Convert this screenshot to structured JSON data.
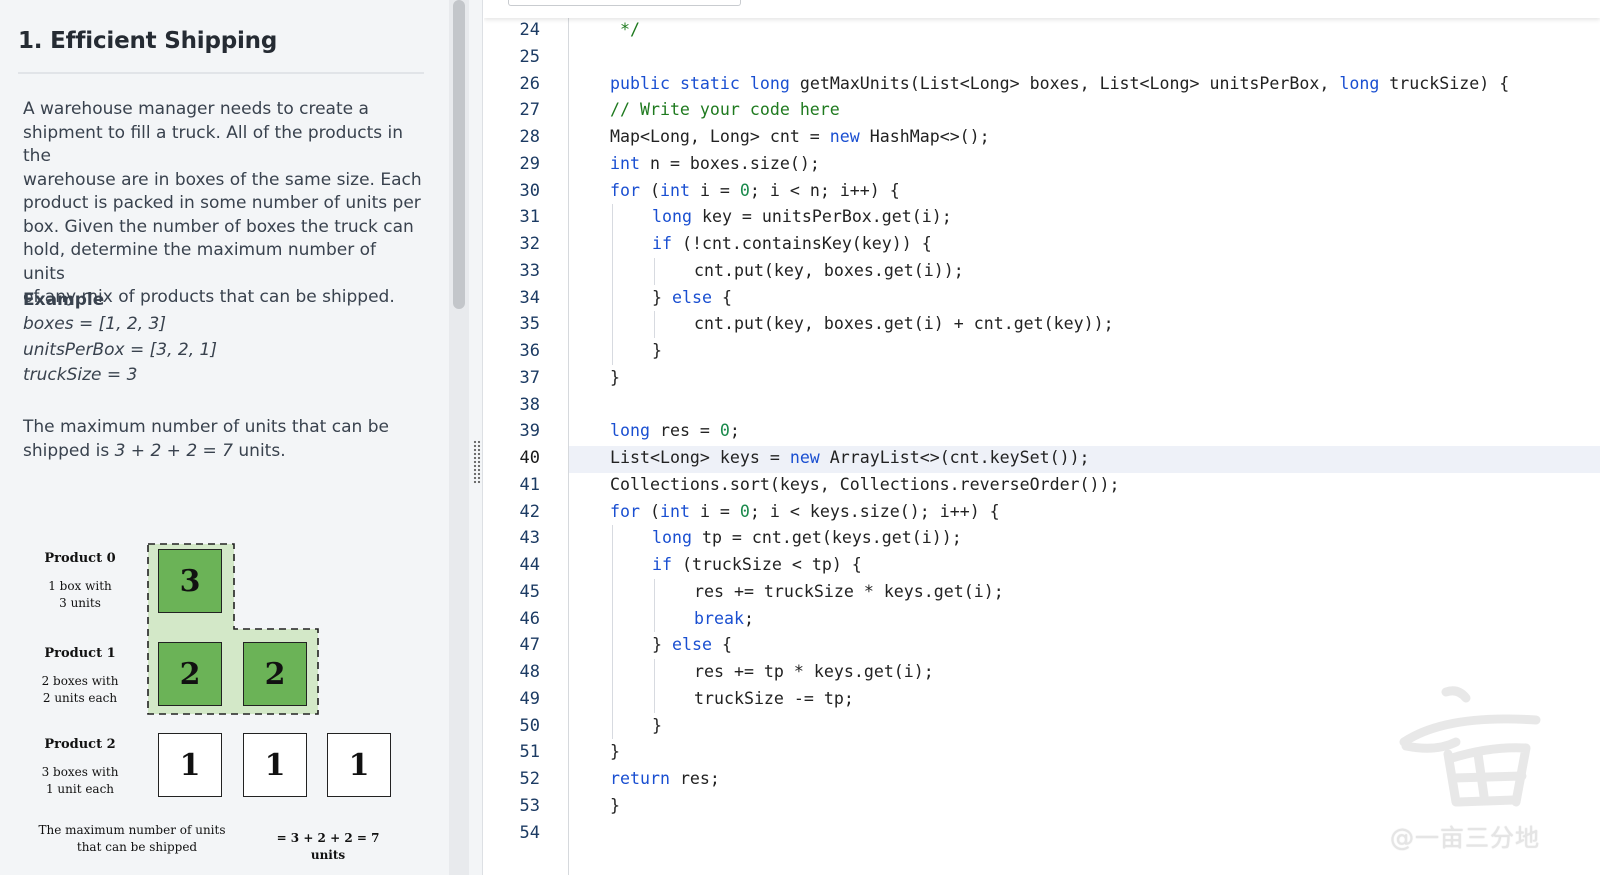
{
  "problem": {
    "title": "1. Efficient Shipping",
    "description": [
      "A warehouse manager needs to create a",
      "shipment to fill a truck. All of the products in the",
      "warehouse are in boxes of the same size. Each",
      "product is packed in some number of units per",
      "box. Given the number of boxes the truck can",
      "hold, determine the maximum number of units",
      "of any mix of products that can be shipped."
    ],
    "example": {
      "heading": "Example",
      "lines": [
        "boxes = [1, 2, 3]",
        "unitsPerBox = [3, 2, 1]",
        "truckSize = 3"
      ],
      "result_prefix_1": "The maximum number of units that can be",
      "result_prefix_2": "shipped is ",
      "result_expr": "3 + 2 + 2 = 7",
      "result_suffix": " units."
    },
    "diagram": {
      "products": [
        {
          "label": "Product 0",
          "sub1": "1 box with",
          "sub2": "3 units",
          "boxes": [
            "3"
          ]
        },
        {
          "label": "Product 1",
          "sub1": "2 boxes with",
          "sub2": "2 units each",
          "boxes": [
            "2",
            "2"
          ]
        },
        {
          "label": "Product 2",
          "sub1": "3 boxes with",
          "sub2": "1 unit each",
          "boxes": [
            "1",
            "1",
            "1"
          ]
        }
      ],
      "footer_left_1": "The maximum number of units",
      "footer_left_2": "that can be shipped",
      "footer_right": "= 3 + 2 + 2 = 7 units"
    }
  },
  "editor": {
    "current_line": 40,
    "lines": [
      {
        "n": "24",
        "indent": 0,
        "tokens": [
          [
            "cm",
            " */"
          ]
        ]
      },
      {
        "n": "25",
        "indent": 0,
        "tokens": []
      },
      {
        "n": "26",
        "indent": 0,
        "tokens": [
          [
            "kw",
            "public"
          ],
          [
            "",
            " "
          ],
          [
            "kw",
            "static"
          ],
          [
            "",
            " "
          ],
          [
            "kw",
            "long"
          ],
          [
            "",
            " getMaxUnits(List<Long> boxes, List<Long> unitsPerBox, "
          ],
          [
            "kw",
            "long"
          ],
          [
            "",
            " truckSize) {"
          ]
        ]
      },
      {
        "n": "27",
        "indent": 0,
        "tokens": [
          [
            "cm",
            "// Write your code here"
          ]
        ]
      },
      {
        "n": "28",
        "indent": 0,
        "tokens": [
          [
            "",
            "Map<Long, Long> cnt = "
          ],
          [
            "kw",
            "new"
          ],
          [
            "",
            " HashMap<>();"
          ]
        ]
      },
      {
        "n": "29",
        "indent": 0,
        "tokens": [
          [
            "kw",
            "int"
          ],
          [
            "",
            " n = boxes.size();"
          ]
        ]
      },
      {
        "n": "30",
        "indent": 0,
        "tokens": [
          [
            "kw",
            "for"
          ],
          [
            "",
            " ("
          ],
          [
            "kw",
            "int"
          ],
          [
            "",
            " i = "
          ],
          [
            "num",
            "0"
          ],
          [
            "",
            "; i < n; i++) {"
          ]
        ]
      },
      {
        "n": "31",
        "indent": 1,
        "tokens": [
          [
            "kw",
            "long"
          ],
          [
            "",
            " key = unitsPerBox.get(i);"
          ]
        ]
      },
      {
        "n": "32",
        "indent": 1,
        "tokens": [
          [
            "kw",
            "if"
          ],
          [
            "",
            " (!cnt.containsKey(key)) {"
          ]
        ]
      },
      {
        "n": "33",
        "indent": 2,
        "tokens": [
          [
            "",
            "cnt.put(key, boxes.get(i));"
          ]
        ]
      },
      {
        "n": "34",
        "indent": 1,
        "tokens": [
          [
            "",
            "} "
          ],
          [
            "kw",
            "else"
          ],
          [
            "",
            " {"
          ]
        ]
      },
      {
        "n": "35",
        "indent": 2,
        "tokens": [
          [
            "",
            "cnt.put(key, boxes.get(i) + cnt.get(key));"
          ]
        ]
      },
      {
        "n": "36",
        "indent": 1,
        "tokens": [
          [
            "",
            "}"
          ]
        ]
      },
      {
        "n": "37",
        "indent": 0,
        "tokens": [
          [
            "",
            "}"
          ]
        ]
      },
      {
        "n": "38",
        "indent": 0,
        "tokens": []
      },
      {
        "n": "39",
        "indent": 0,
        "tokens": [
          [
            "kw",
            "long"
          ],
          [
            "",
            " res = "
          ],
          [
            "num",
            "0"
          ],
          [
            "",
            ";"
          ]
        ]
      },
      {
        "n": "40",
        "indent": 0,
        "tokens": [
          [
            "",
            "List<Long> keys = "
          ],
          [
            "kw",
            "new"
          ],
          [
            "",
            " ArrayList<>(cnt.keySet());"
          ]
        ]
      },
      {
        "n": "41",
        "indent": 0,
        "tokens": [
          [
            "",
            "Collections.sort(keys, Collections.reverseOrder());"
          ]
        ]
      },
      {
        "n": "42",
        "indent": 0,
        "tokens": [
          [
            "kw",
            "for"
          ],
          [
            "",
            " ("
          ],
          [
            "kw",
            "int"
          ],
          [
            "",
            " i = "
          ],
          [
            "num",
            "0"
          ],
          [
            "",
            "; i < keys.size(); i++) {"
          ]
        ]
      },
      {
        "n": "43",
        "indent": 1,
        "tokens": [
          [
            "kw",
            "long"
          ],
          [
            "",
            " tp = cnt.get(keys.get(i));"
          ]
        ]
      },
      {
        "n": "44",
        "indent": 1,
        "tokens": [
          [
            "kw",
            "if"
          ],
          [
            "",
            " (truckSize < tp) {"
          ]
        ]
      },
      {
        "n": "45",
        "indent": 2,
        "tokens": [
          [
            "",
            "res += truckSize * keys.get(i);"
          ]
        ]
      },
      {
        "n": "46",
        "indent": 2,
        "tokens": [
          [
            "kw",
            "break"
          ],
          [
            "",
            ";"
          ]
        ]
      },
      {
        "n": "47",
        "indent": 1,
        "tokens": [
          [
            "",
            "} "
          ],
          [
            "kw",
            "else"
          ],
          [
            "",
            " {"
          ]
        ]
      },
      {
        "n": "48",
        "indent": 2,
        "tokens": [
          [
            "",
            "res += tp * keys.get(i);"
          ]
        ]
      },
      {
        "n": "49",
        "indent": 2,
        "tokens": [
          [
            "",
            "truckSize -= tp;"
          ]
        ]
      },
      {
        "n": "50",
        "indent": 1,
        "tokens": [
          [
            "",
            "}"
          ]
        ]
      },
      {
        "n": "51",
        "indent": 0,
        "tokens": [
          [
            "",
            "}"
          ]
        ]
      },
      {
        "n": "52",
        "indent": 0,
        "tokens": [
          [
            "kw",
            "return"
          ],
          [
            "",
            " res;"
          ]
        ]
      },
      {
        "n": "53",
        "indent": 0,
        "tokens": [
          [
            "",
            "}"
          ]
        ]
      },
      {
        "n": "54",
        "indent": 0,
        "tokens": []
      }
    ]
  },
  "watermark": {
    "text": "@一亩三分地"
  },
  "colors": {
    "keyword": "#1a4fd1",
    "comment": "#1f7a1f",
    "number": "#1b8a4c",
    "box_green": "#6bb357",
    "region_green": "#d3e8c8"
  }
}
